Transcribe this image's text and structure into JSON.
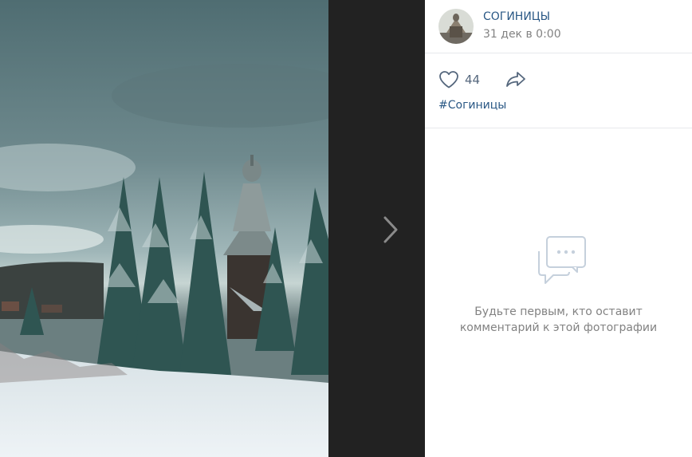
{
  "post": {
    "author": "СОГИНИЦЫ",
    "date": "31 дек в 0:00",
    "likes": "44",
    "hashtag": "#Согиницы"
  },
  "comments": {
    "empty_line1": "Будьте первым, кто оставит",
    "empty_line2": "комментарий к этой фотографии"
  },
  "icons": {
    "like": "heart-icon",
    "share": "share-arrow-icon",
    "next": "chevron-right-icon",
    "comments": "speech-bubble-icon"
  },
  "colors": {
    "link": "#2a5885",
    "muted": "#828282",
    "icon": "#55677d",
    "divider": "#e7e8ec",
    "viewer_bg": "#222222"
  }
}
